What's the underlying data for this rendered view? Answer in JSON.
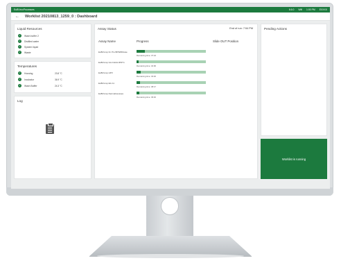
{
  "app": {
    "name": "EuBVxvxProcesses"
  },
  "statusbar": {
    "items": [
      "6.6.0",
      "Wifi",
      "1:00 PM"
    ],
    "logo": "EXXXX"
  },
  "header": {
    "back_icon": "arrow-left-icon",
    "title": "Worklist 20210813_1259_0 : Dashboard"
  },
  "liquid_resources": {
    "title": "Liquid Resources",
    "items": [
      "Wash buffer 2",
      "Distilled water",
      "System liquid",
      "Waste"
    ]
  },
  "temperatures": {
    "title": "Temperatures",
    "items": [
      {
        "label": "Housing",
        "value": "23.8 °C"
      },
      {
        "label": "Incubator",
        "value": "36.9 °C"
      },
      {
        "label": "Wash Buffer",
        "value": "24.3 °C"
      }
    ]
  },
  "log": {
    "title": "Log",
    "icon": "clipboard-icon"
  },
  "assay_status": {
    "title": "Assay Status",
    "end_of_run": "End of run: 7:54 PM",
    "col_name": "Assay Name",
    "col_progress": "Progress",
    "col_slide": "Slide OUT Position",
    "rows": [
      {
        "name": "EuBVxvxp Fn Pro BPWRDiswe",
        "progress": 0.12,
        "remaining": "Remaining time: 37:24"
      },
      {
        "name": "EuBVxvxp GLU EGG RWTn",
        "progress": 0.03,
        "remaining": "Remaining time: 32:96"
      },
      {
        "name": "EuBVxvxp HPV",
        "progress": 0.06,
        "remaining": "Remaining time: 33:40"
      },
      {
        "name": "EuBVxvxp EG 11",
        "progress": 0.05,
        "remaining": "Remaining time: 38:17"
      },
      {
        "name": "EuBVxvxp Dermalinessses",
        "progress": 0.04,
        "remaining": "Remaining time: 39:40"
      }
    ]
  },
  "pending_actions": {
    "title": "Pending Actions"
  },
  "running_banner": {
    "text": "Worklist is running",
    "color": "#1c7a3e"
  },
  "colors": {
    "accent": "#1c7a3e",
    "bar_track": "#a8d2b4"
  }
}
